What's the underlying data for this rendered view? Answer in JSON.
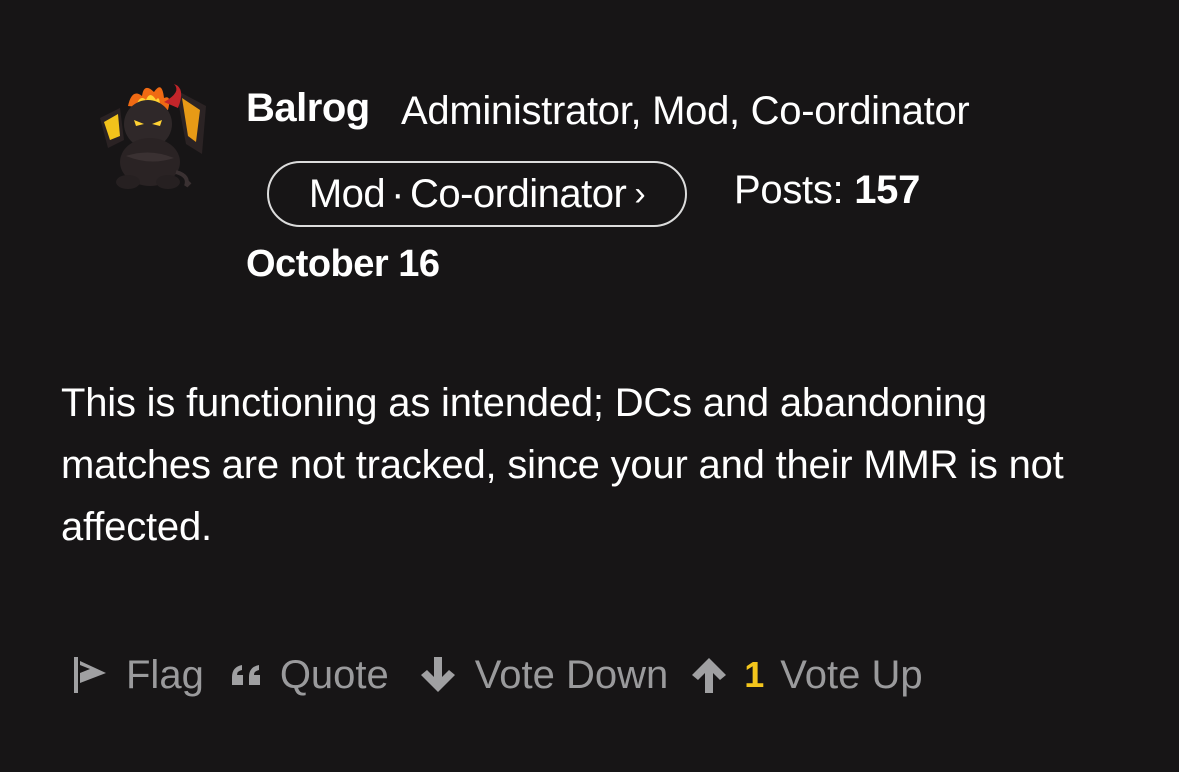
{
  "author": {
    "name": "Balrog",
    "title": "Administrator, Mod, Co-ordinator",
    "avatar_icon": "devil-mascot-icon"
  },
  "roles": {
    "first": "Mod",
    "separator": "·",
    "second": "Co-ordinator",
    "chevron": "›"
  },
  "stats": {
    "posts_label": "Posts:",
    "posts_count": "157"
  },
  "post": {
    "date": "October 16",
    "body": "This is functioning as intended; DCs and abandoning matches are not tracked, since your and their MMR is not affected."
  },
  "actions": {
    "flag_label": "Flag",
    "quote_label": "Quote",
    "vote_down_label": "Vote Down",
    "vote_up_count": "1",
    "vote_up_label": "Vote Up"
  },
  "colors": {
    "background": "#171516",
    "text": "#ffffff",
    "muted": "#9a9a9c",
    "vote_count": "#f3c51c"
  }
}
